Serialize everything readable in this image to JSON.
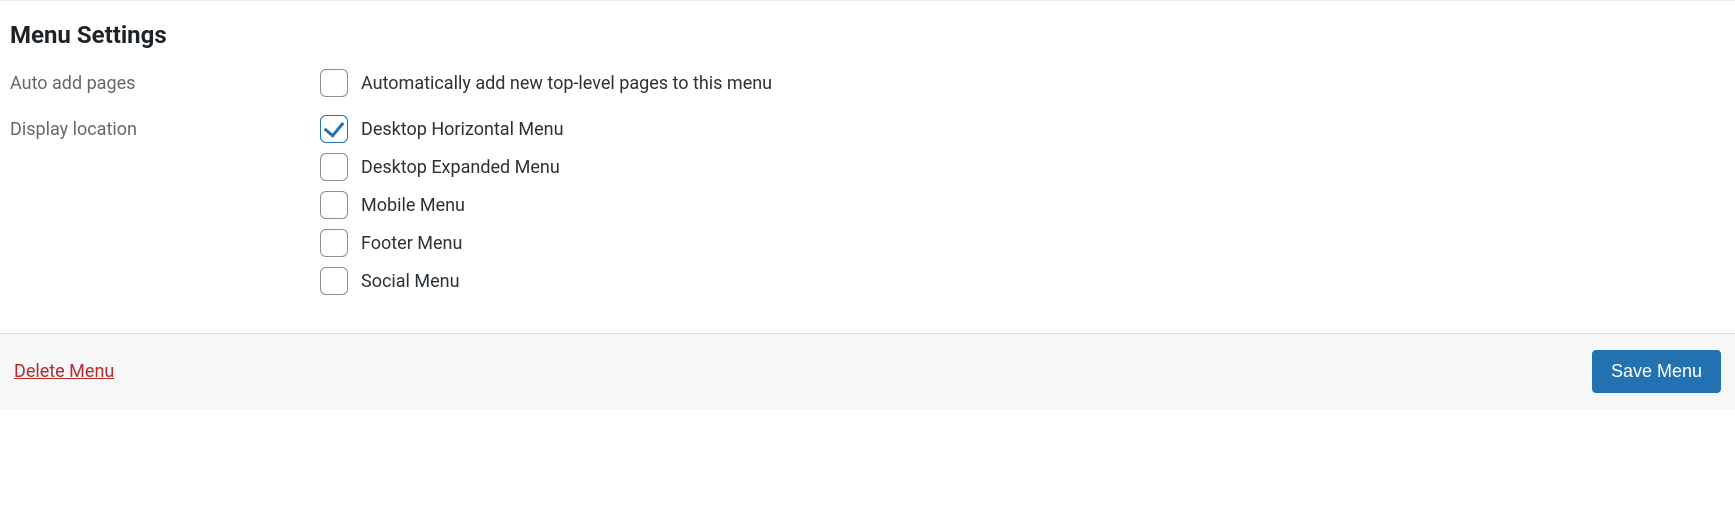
{
  "section_title": "Menu Settings",
  "auto_add": {
    "label": "Auto add pages",
    "checkbox_label": "Automatically add new top-level pages to this menu",
    "checked": false
  },
  "display_location": {
    "label": "Display location",
    "options": [
      {
        "label": "Desktop Horizontal Menu",
        "checked": true
      },
      {
        "label": "Desktop Expanded Menu",
        "checked": false
      },
      {
        "label": "Mobile Menu",
        "checked": false
      },
      {
        "label": "Footer Menu",
        "checked": false
      },
      {
        "label": "Social Menu",
        "checked": false
      }
    ]
  },
  "footer": {
    "delete_label": "Delete Menu",
    "save_label": "Save Menu"
  }
}
